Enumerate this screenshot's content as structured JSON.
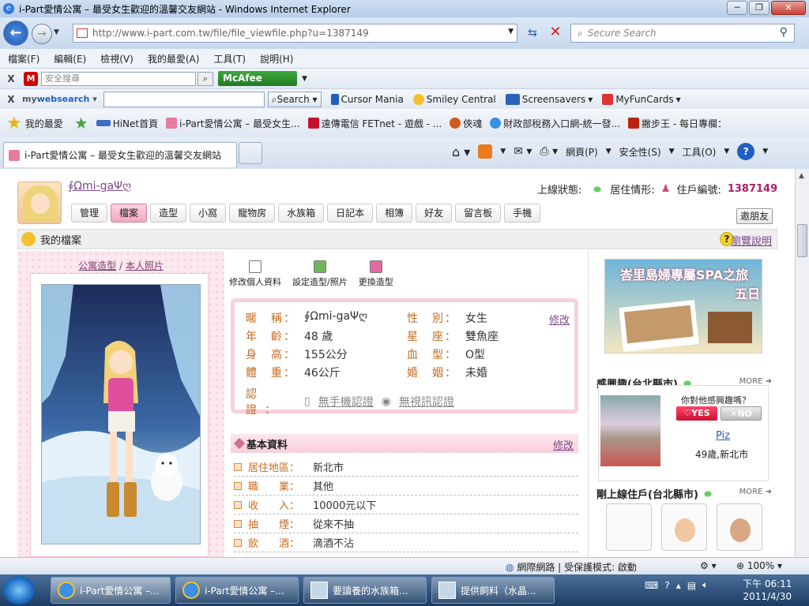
{
  "window": {
    "title": "i-Part愛情公寓 – 最受女生歡迎的溫馨交友網站 - Windows Internet Explorer"
  },
  "address": {
    "url": "http://www.i-part.com.tw/file/file_viewfile.php?u=1387149",
    "search_placeholder": "Secure Search"
  },
  "menu": [
    "檔案(F)",
    "編輯(E)",
    "檢視(V)",
    "我的最愛(A)",
    "工具(T)",
    "說明(H)"
  ],
  "toolbar1": {
    "search_placeholder": "安全搜尋",
    "mcafee": "McAfee"
  },
  "toolbar2": {
    "brand_a": "my",
    "brand_b": "websearch",
    "search_btn": "Search",
    "items": [
      "Cursor Mania",
      "Smiley Central",
      "Screensavers",
      "MyFunCards"
    ]
  },
  "favorites": {
    "label": "我的最愛",
    "items": [
      "HiNet首頁",
      "i-Part愛情公寓 – 最受女生...",
      "遠傳電信 FETnet - 遊戲 - ...",
      "俠魂",
      "財政部稅務入口網-統一發...",
      "撇步王 - 每日專欄："
    ]
  },
  "tab": {
    "title": "i-Part愛情公寓 – 最受女生歡迎的溫馨交友網站"
  },
  "commandbar": {
    "page": "網頁(P)",
    "safety": "安全性(S)",
    "tools": "工具(O)"
  },
  "profile": {
    "username": "∮Ωmi-gaΨღ",
    "online_label": "上線狀態:",
    "residence_label": "居住情形:",
    "id_label": "住戶編號:",
    "id_value": "1387149",
    "tabs": [
      "管理",
      "檔案",
      "造型",
      "小窩",
      "寵物房",
      "水族箱",
      "日記本",
      "相簿",
      "好友",
      "留言板",
      "手機"
    ],
    "invite": "邀朋友",
    "section_title": "我的檔案",
    "help": "瀏覽說明"
  },
  "leftpanel": {
    "tab_a": "公寓造型",
    "sep": "/",
    "tab_b": "本人照片"
  },
  "actions": [
    "修改個人資料",
    "設定造型/照片",
    "更換造型"
  ],
  "details": {
    "nickname_k": "暱　稱：",
    "nickname_v": "∮Ωmi-gaΨღ",
    "age_k": "年　齡：",
    "age_v": "48 歲",
    "height_k": "身　高：",
    "height_v": "155公分",
    "weight_k": "體　重：",
    "weight_v": "46公斤",
    "gender_k": "性　別：",
    "gender_v": "女生",
    "sign_k": "星　座：",
    "sign_v": "雙魚座",
    "blood_k": "血　型：",
    "blood_v": "O型",
    "marital_k": "婚　姻：",
    "marital_v": "未婚",
    "verify_k": "認證：",
    "phone_verify": "無手機認證",
    "video_verify": "無視訊認證",
    "edit": "修改"
  },
  "basic": {
    "title": "基本資料",
    "edit": "修改",
    "rows": [
      {
        "k": "居住地區：",
        "v": "新北市"
      },
      {
        "k": "職　　業：",
        "v": "其他"
      },
      {
        "k": "收　　入：",
        "v": "10000元以下"
      },
      {
        "k": "抽　　煙：",
        "v": "從來不抽"
      },
      {
        "k": "飲　　酒：",
        "v": "滴酒不沾"
      }
    ]
  },
  "right": {
    "ad_line1": "峇里島婦專屬SPA之旅",
    "ad_line2": "五日",
    "interest_title": "感興趣(台北縣市)",
    "more": "MORE",
    "question": "你對他感興趣嗎？",
    "yes": "YES",
    "no": "NO",
    "match_name": "Piz",
    "match_info": "49歲,新北市",
    "online_title": "剛上線住戶(台北縣市)"
  },
  "statusbar": {
    "zone": "網際網路 | 受保護模式: 啟動",
    "zoom": "100%"
  },
  "taskbar": {
    "tasks": [
      "i-Part愛情公寓 –...",
      "i-Part愛情公寓 –...",
      "要讀養的水族箱...",
      "提供飼料（水晶..."
    ],
    "time": "下午 06:11",
    "date": "2011/4/30"
  }
}
